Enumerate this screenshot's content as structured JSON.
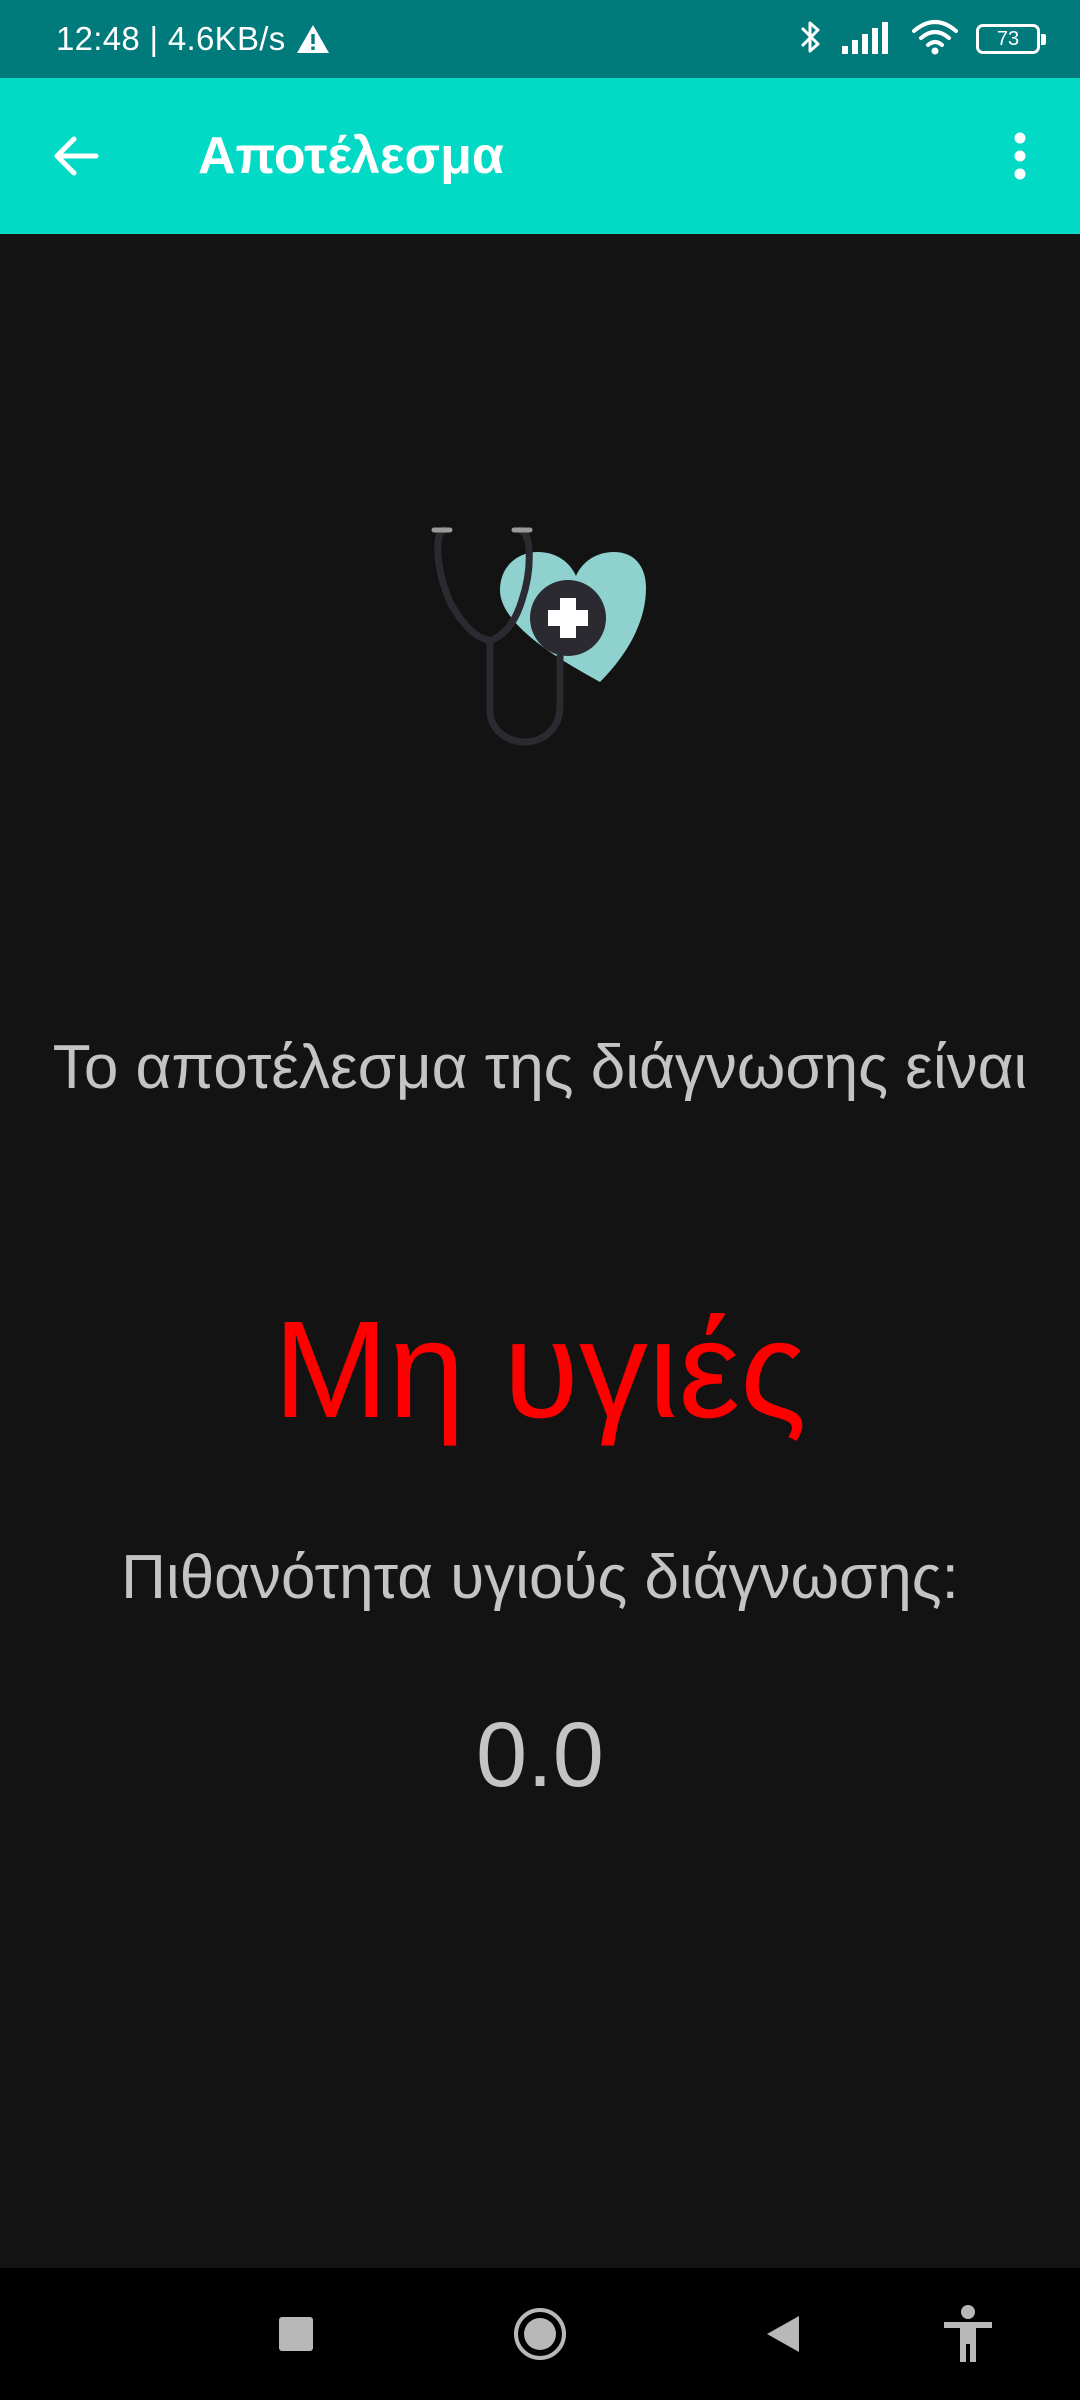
{
  "status_bar": {
    "time_speed": "12:48 | 4.6KB/s",
    "battery_level": "73",
    "icons": [
      "warning-icon",
      "bluetooth-icon",
      "signal-icon",
      "wifi-icon",
      "battery-icon"
    ]
  },
  "app_bar": {
    "title": "Αποτέλεσμα",
    "background_color": "#03dac5",
    "back_icon": "arrow-left-icon",
    "menu_icon": "more-vertical-icon"
  },
  "content": {
    "illustration_icon": "stethoscope-heart-icon",
    "intro_text": "Το αποτέλεσμα της διάγνωσης είναι",
    "diagnosis": "Μη υγιές",
    "diagnosis_color": "#ff0000",
    "probability_label": "Πιθανότητα υγιούς διάγνωσης:",
    "probability_value": "0.0"
  },
  "nav_bar": {
    "icons": [
      "recents-square-icon",
      "home-circle-icon",
      "back-triangle-icon",
      "accessibility-icon"
    ]
  }
}
